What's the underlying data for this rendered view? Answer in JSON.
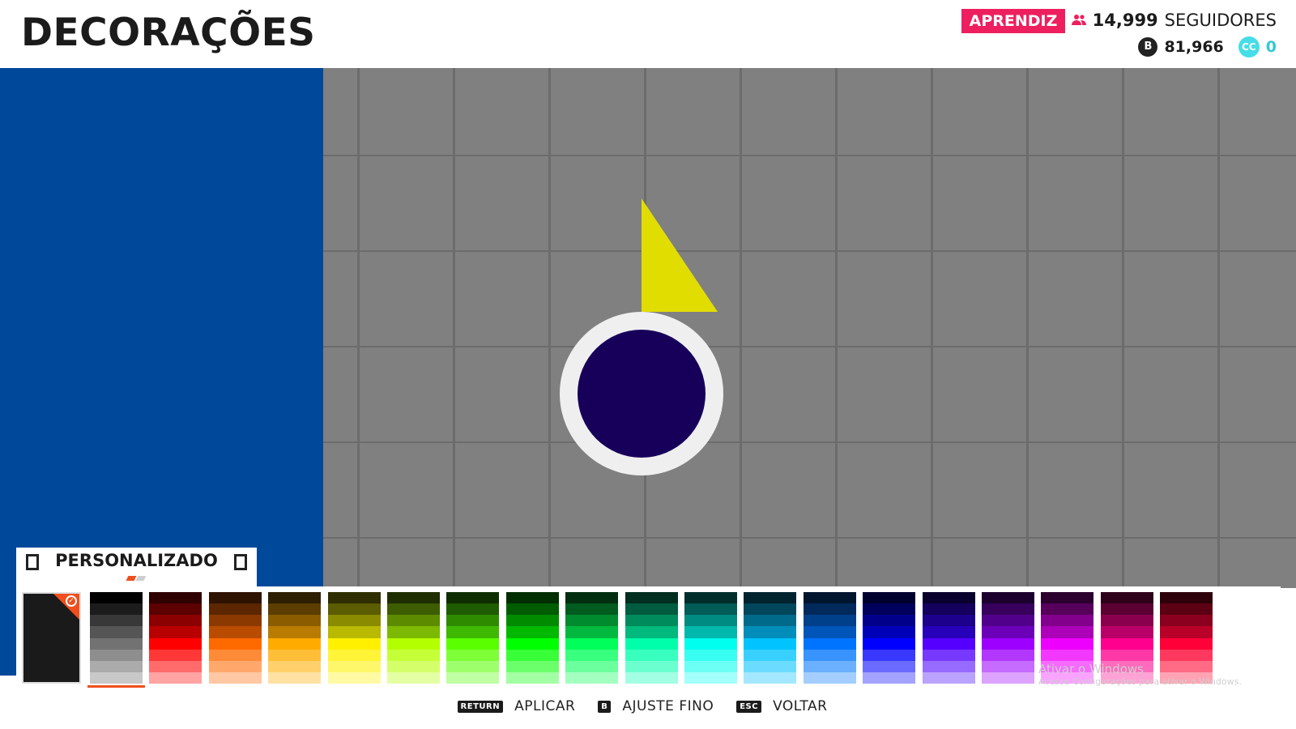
{
  "header": {
    "title": "DECORAÇÕES",
    "rank": "APRENDIZ",
    "followers_count": "14,999",
    "followers_label": "SEGUIDORES",
    "coins": "81,966",
    "coin_icon_glyph": "B",
    "cc_icon_glyph": "CC",
    "cc_value": "0",
    "rank_color": "#ee1f5e"
  },
  "preview": {
    "color": "#004899"
  },
  "canvas": {
    "shape_colors": {
      "triangle": "#e2dd00",
      "circle_fill": "#17005a",
      "circle_ring": "#efeff0"
    }
  },
  "palette": {
    "name": "PERSONALIZADO",
    "prev_icon": "bracket-left-icon",
    "next_icon": "bracket-right-icon",
    "custom_slot_color": "#1a1a1a",
    "accent": "#f04e1d",
    "selected_column": 0,
    "columns": [
      [
        "#000000",
        "#1c1c1c",
        "#383838",
        "#555555",
        "#727272",
        "#8e8e8e",
        "#ababab",
        "#c8c8c8"
      ],
      [
        "#2e0000",
        "#5c0000",
        "#8b0000",
        "#b90000",
        "#ff0000",
        "#ff3737",
        "#ff6b6b",
        "#ffa3a3"
      ],
      [
        "#2e1300",
        "#5c2600",
        "#8b3900",
        "#b94c00",
        "#ff6a00",
        "#ff8a38",
        "#ffa86b",
        "#ffc8a3"
      ],
      [
        "#2e1f00",
        "#5c3e00",
        "#8b5d00",
        "#b97c00",
        "#ffab00",
        "#ffbe38",
        "#ffd06b",
        "#ffe2a3"
      ],
      [
        "#2e2e00",
        "#5c5c00",
        "#8b8b00",
        "#b9b900",
        "#fff000",
        "#fff438",
        "#fff76b",
        "#fffaa3"
      ],
      [
        "#1f2e00",
        "#3e5c00",
        "#5d8b00",
        "#7cb900",
        "#b3ff00",
        "#c5ff38",
        "#d4ff6b",
        "#e4ffa3"
      ],
      [
        "#0f2e00",
        "#1f5c00",
        "#2e8b00",
        "#3eb900",
        "#5aff00",
        "#7eff38",
        "#9dff6b",
        "#c0ffa3"
      ],
      [
        "#002e00",
        "#005c00",
        "#008b00",
        "#00b900",
        "#00ff00",
        "#38ff38",
        "#6bff6b",
        "#a3ffa3"
      ],
      [
        "#002e0f",
        "#005c1f",
        "#008b2e",
        "#00b93e",
        "#00ff5a",
        "#38ff7e",
        "#6bff9d",
        "#a3ffc0"
      ],
      [
        "#002e1f",
        "#005c3e",
        "#008b5d",
        "#00b97c",
        "#00ffab",
        "#38ffbe",
        "#6bffd0",
        "#a3ffe2"
      ],
      [
        "#002e2b",
        "#005c56",
        "#008b82",
        "#00b9ad",
        "#00ffee",
        "#38fff2",
        "#6bfff5",
        "#a3fff9"
      ],
      [
        "#00232e",
        "#00475c",
        "#006a8b",
        "#008db9",
        "#00c3ff",
        "#38d0ff",
        "#6bdcff",
        "#a3e8ff"
      ],
      [
        "#00152e",
        "#002a5c",
        "#00408b",
        "#0055b9",
        "#0073ff",
        "#3893ff",
        "#6bb0ff",
        "#a3ceff"
      ],
      [
        "#00002e",
        "#00005c",
        "#00008b",
        "#0000b9",
        "#0000ff",
        "#3838ff",
        "#6b6bff",
        "#a3a3ff"
      ],
      [
        "#0a002e",
        "#13005c",
        "#1d008b",
        "#2700b9",
        "#5500ff",
        "#7738ff",
        "#976bff",
        "#baa3ff"
      ],
      [
        "#1b002e",
        "#36005c",
        "#51008b",
        "#6c00b9",
        "#9d00ff",
        "#b238ff",
        "#c66bff",
        "#dca3ff"
      ],
      [
        "#2b002e",
        "#56005c",
        "#82008b",
        "#ad00b9",
        "#ee00ff",
        "#f238ff",
        "#f56bff",
        "#f9a3ff"
      ],
      [
        "#2e001a",
        "#5c0034",
        "#8b004e",
        "#b90068",
        "#ff008e",
        "#ff38a7",
        "#ff6bbd",
        "#ffa3d6"
      ],
      [
        "#2e000a",
        "#5c0014",
        "#8b001e",
        "#b90028",
        "#ff0038",
        "#ff385f",
        "#ff6b85",
        "#ffa3b3"
      ]
    ]
  },
  "footer": {
    "actions": [
      {
        "key": "RETURN",
        "label": "APLICAR"
      },
      {
        "key": "B",
        "label": "AJUSTE FINO"
      },
      {
        "key": "ESC",
        "label": "VOLTAR"
      }
    ]
  },
  "watermark": {
    "line1": "Ativar o Windows",
    "line2": "Acesse Configurações para ativar o Windows."
  }
}
